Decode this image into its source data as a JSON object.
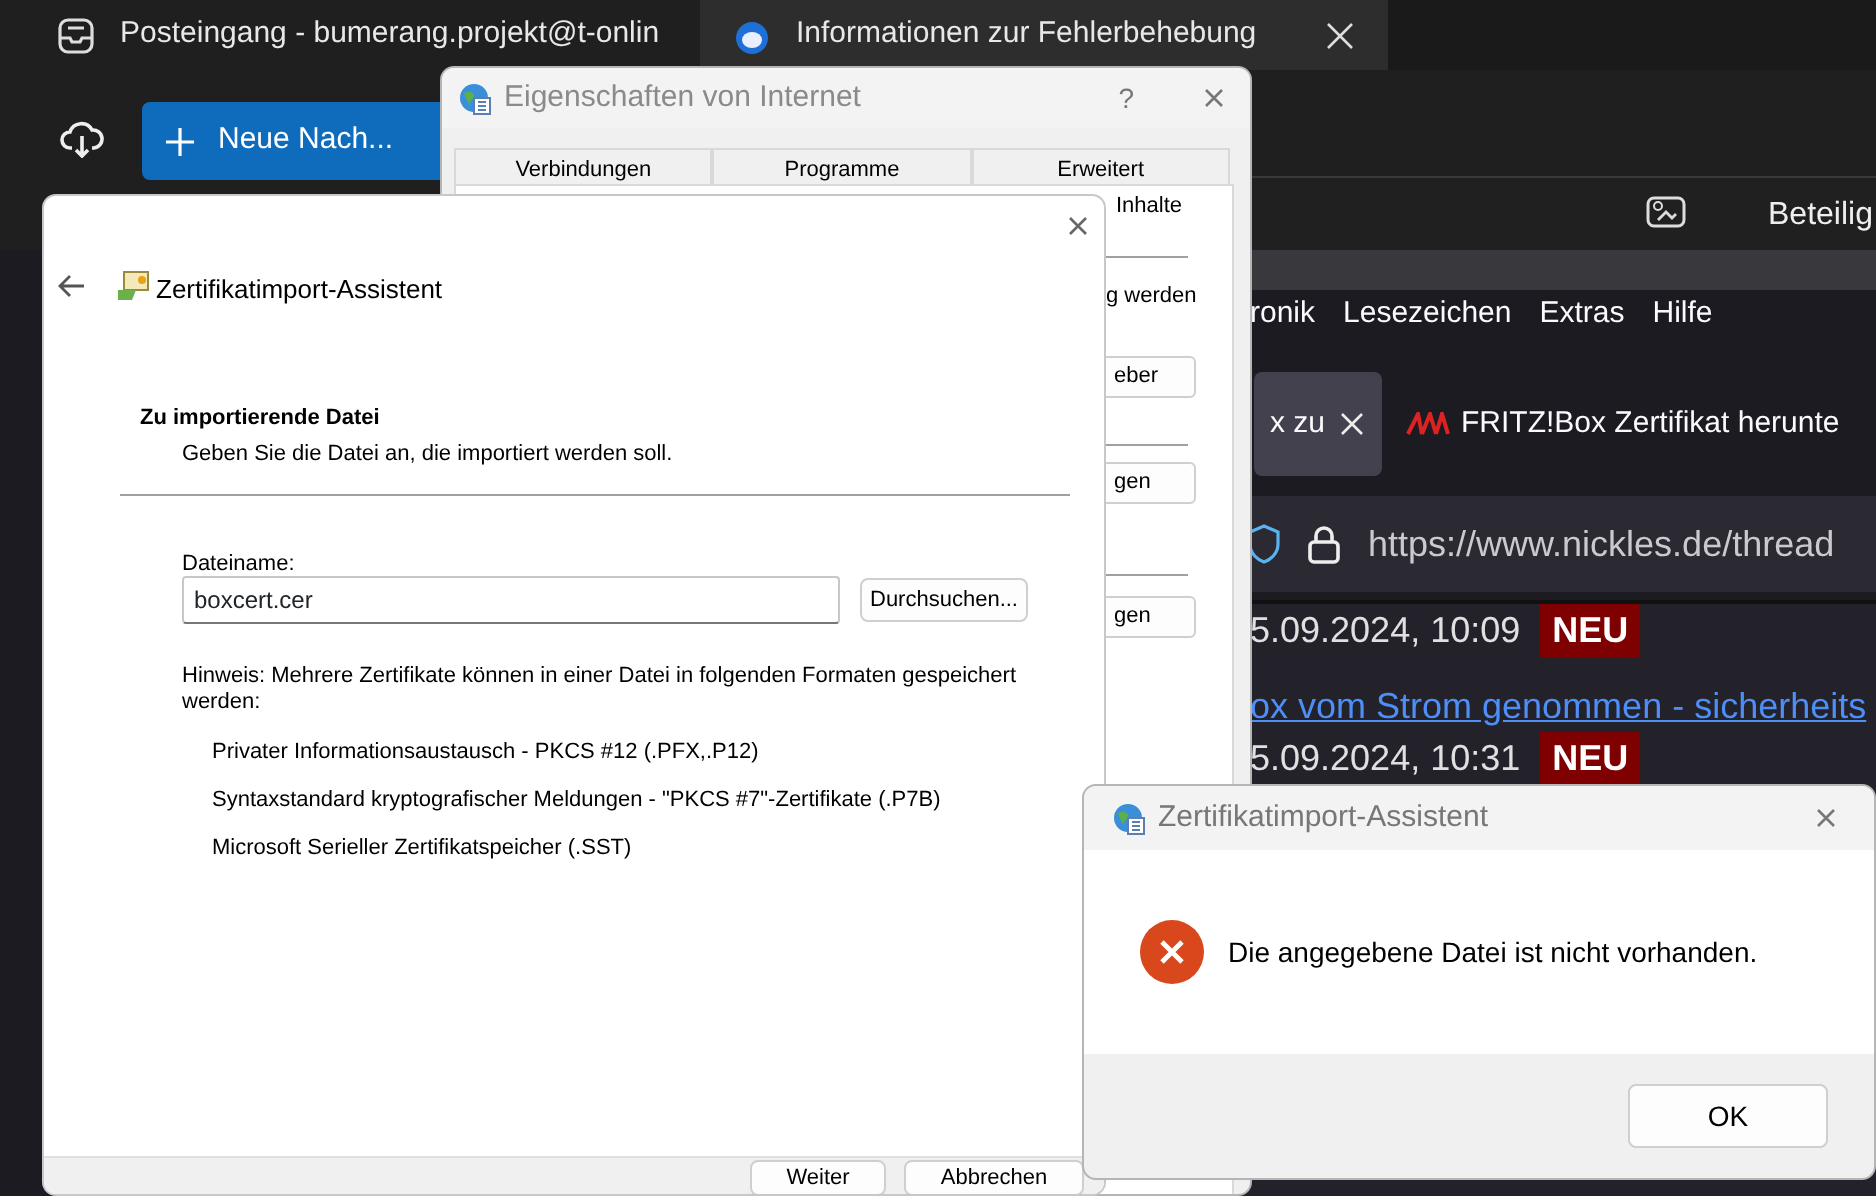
{
  "mail_app": {
    "tabs": [
      {
        "label": "Posteingang - bumerang.projekt@t-onlin",
        "selected": false
      },
      {
        "label": "Informationen zur Fehlerbehebung",
        "selected": true
      }
    ],
    "new_message_button": "Neue Nach...",
    "toolbar_label": "Beteilig"
  },
  "browser": {
    "menu": [
      "ronik",
      "Lesezeichen",
      "Extras",
      "Hilfe"
    ],
    "tabs": [
      {
        "label": "x zu",
        "selected": true
      },
      {
        "label": "FRITZ!Box Zertifikat herunte",
        "selected": false
      }
    ],
    "url": "https://www.nickles.de/thread",
    "posts": [
      {
        "kind": "date",
        "text": "5.09.2024, 10:09",
        "badge": "NEU"
      },
      {
        "kind": "link",
        "text": "ox vom Strom genommen - sicherheits"
      },
      {
        "kind": "date",
        "text": "5.09.2024, 10:31",
        "badge": "NEU"
      }
    ]
  },
  "internet_options": {
    "title": "Eigenschaften von Internet",
    "help": "?",
    "tabs": [
      {
        "label": "Verbindungen",
        "selected": false
      },
      {
        "label": "Programme",
        "selected": false
      },
      {
        "label": "Erweitert",
        "selected": false
      },
      {
        "label": "Inhalte",
        "selected": true
      }
    ],
    "text": "g werden",
    "buttons": [
      "eber",
      "gen",
      "gen"
    ]
  },
  "wizard": {
    "title": "Zertifikatimport-Assistent",
    "heading": "Zu importierende Datei",
    "subheading": "Geben Sie die Datei an, die importiert werden soll.",
    "file_label": "Dateiname:",
    "file_value": "boxcert.cer",
    "browse_button": "Durchsuchen...",
    "hint": "Hinweis: Mehrere Zertifikate können in einer Datei in folgenden Formaten gespeichert werden:",
    "formats": [
      "Privater Informationsaustausch - PKCS #12 (.PFX,.P12)",
      "Syntaxstandard kryptografischer Meldungen - \"PKCS #7\"-Zertifikate (.P7B)",
      "Microsoft Serieller Zertifikatspeicher (.SST)"
    ],
    "buttons": [
      "Weiter",
      "Abbrechen"
    ]
  },
  "error_dialog": {
    "title": "Zertifikatimport-Assistent",
    "message": "Die angegebene Datei ist nicht vorhanden.",
    "button": "OK"
  }
}
